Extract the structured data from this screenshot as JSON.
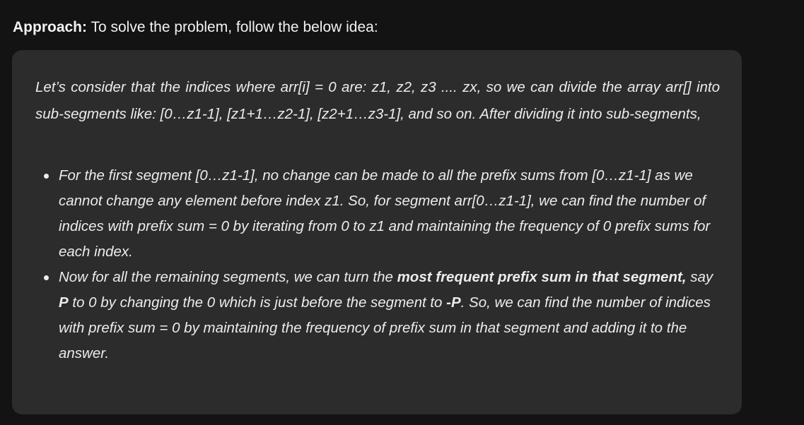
{
  "heading": {
    "label": "Approach:",
    "text": " To solve the problem, follow the below idea:"
  },
  "panel": {
    "intro": "Let’s consider that the indices where arr[i] = 0 are: z1, z2, z3 .... zx, so we can divide the array arr[] into sub-segments like: [0…z1-1], [z1+1…z2-1], [z2+1…z3-1], and so on. After dividing it into sub-segments,",
    "bullet1": "For the first segment [0…z1-1], no change can be made to all the prefix sums from [0…z1-1] as we cannot change any element before index z1. So, for segment arr[0…z1-1], we can find the number of indices with prefix sum = 0 by iterating from 0 to z1 and maintaining the frequency of 0 prefix sums for each index.",
    "bullet2": {
      "t1": "Now for all the remaining segments, we can turn the ",
      "b1": "most frequent prefix sum in that segment,",
      "t2": " say ",
      "b2": "P",
      "t3": " to 0 by changing the 0 which is just before the segment to ",
      "b3": "-P",
      "t4": ". So, we can find the number of indices with prefix sum = 0 by maintaining the frequency of prefix sum in that segment and adding it to the answer."
    }
  }
}
